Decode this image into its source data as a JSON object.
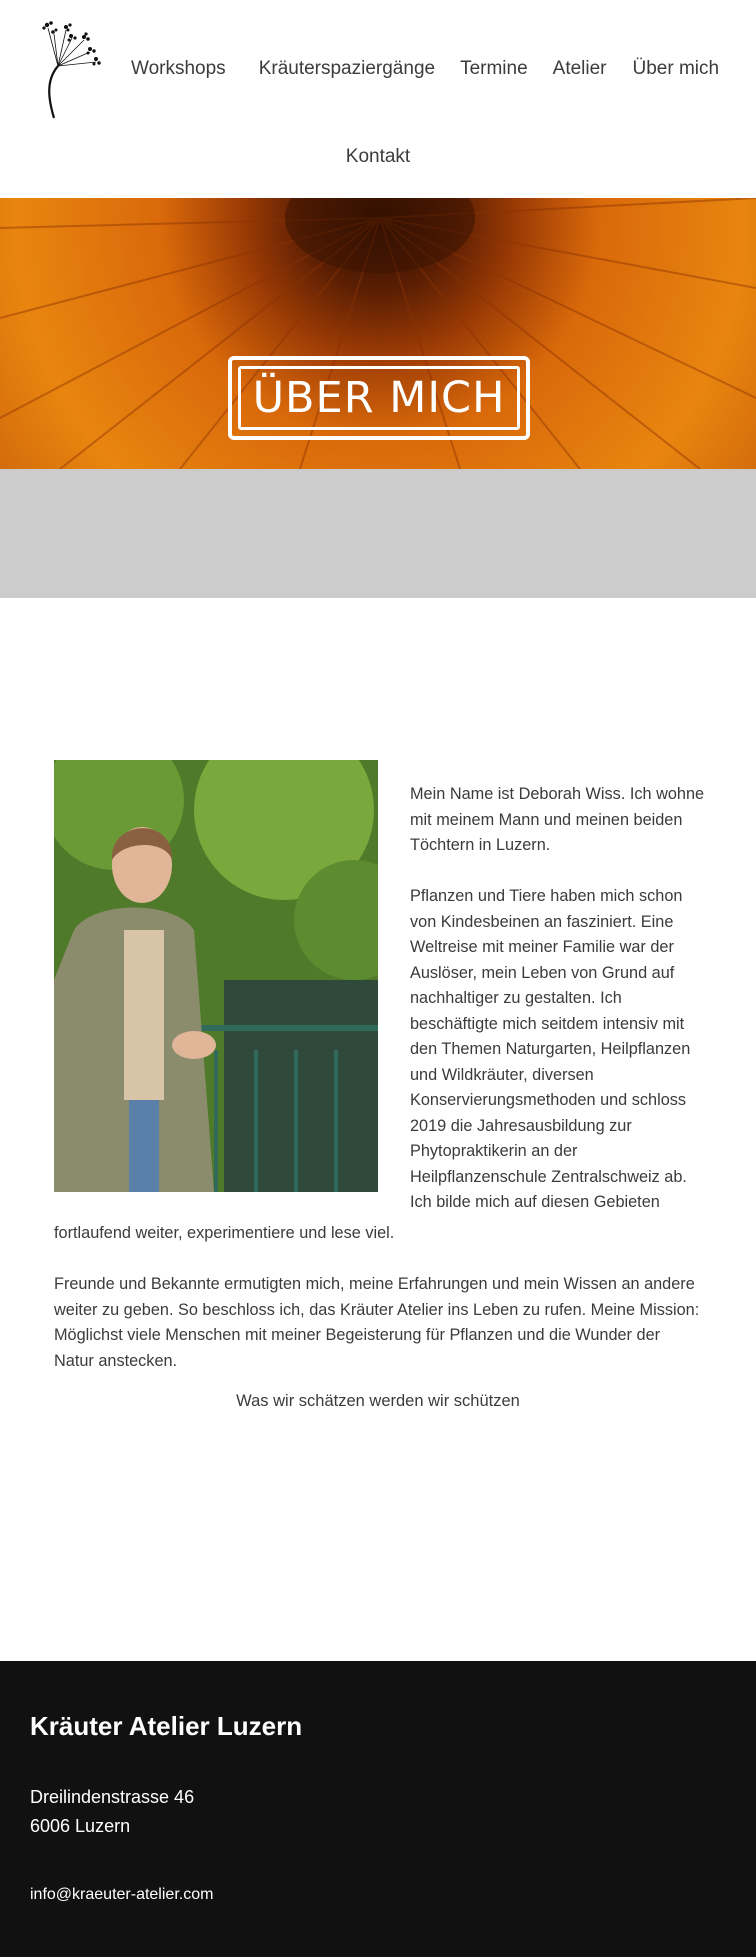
{
  "nav": {
    "items": [
      {
        "label": "Workshops"
      },
      {
        "label": "Kräuterspaziergänge"
      },
      {
        "label": "Termine"
      },
      {
        "label": "Atelier"
      },
      {
        "label": "Über mich"
      }
    ],
    "kontakt": "Kontakt"
  },
  "hero": {
    "title": "ÜBER MICH",
    "colors": {
      "orange": "#e27a0c",
      "dark": "#7a2c04"
    }
  },
  "about": {
    "p1": "Mein Name ist Deborah Wiss. Ich wohne mit meinem Mann und meinen beiden Töchtern in Luzern.",
    "p2_right": "Pflanzen und Tiere haben mich schon von Kindesbeinen an fasziniert. Eine Weltreise mit meiner Familie war der Auslöser, mein Leben von Grund auf nachhaltiger zu gestalten. Ich beschäftigte mich seitdem intensiv mit den Themen Naturgarten, Heilpflanzen und Wildkräuter, diversen Konservierungsmethoden und schloss 2019 die Jahresausbildung zur Phytopraktikerin an der Heilpflanzenschule Zentralschweiz ab. Ich bilde mich auf diesen Gebieten",
    "p2_cont": "fortlaufend weiter, experimentiere und lese viel.",
    "p3": "Freunde und Bekannte ermutigten mich, meine Erfahrungen und mein Wissen an andere weiter zu geben. So beschloss ich, das Kräuter Atelier ins Leben zu rufen. Meine Mission: Möglichst viele Menschen mit meiner Begeisterung für Pflanzen und die Wunder der Natur anstecken.",
    "motto": "Was wir schätzen werden wir schützen"
  },
  "footer": {
    "title": "Kräuter Atelier Luzern",
    "street": "Dreilindenstrasse 46",
    "city": "6006 Luzern",
    "email": "info@kraeuter-atelier.com"
  }
}
